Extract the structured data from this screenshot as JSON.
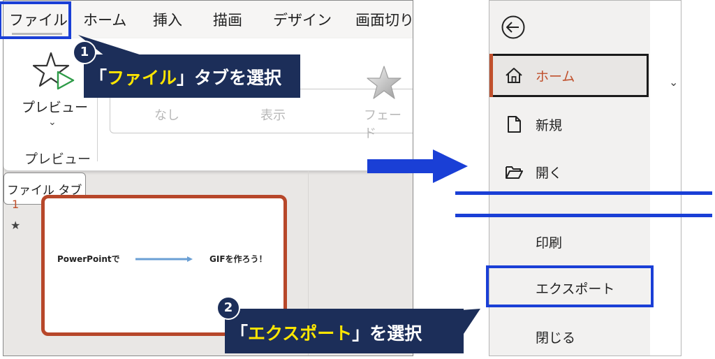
{
  "ribbon": {
    "tabs": [
      "ファイル",
      "ホーム",
      "挿入",
      "描画",
      "デザイン",
      "画面切り"
    ],
    "preview_button_label": "プレビュー",
    "preview_group_label": "プレビュー",
    "effects": [
      "なし",
      "表示",
      "フェード"
    ],
    "tooltip": "ファイル タブ"
  },
  "slide_panel": {
    "slide_number": "1",
    "slide_text_left": "PowerPointで",
    "slide_text_right": "GIFを作ろう！"
  },
  "callouts": {
    "step1_badge": "1",
    "step1_open": "「",
    "step1_highlight": "ファイル",
    "step1_close": "」タブを選択",
    "step2_badge": "2",
    "step2_open": "「",
    "step2_highlight": "エクスポート",
    "step2_close": "」を選択"
  },
  "backstage": {
    "home": "ホーム",
    "new": "新規",
    "open": "開く",
    "print": "印刷",
    "export": "エクスポート",
    "close": "閉じる"
  },
  "colors": {
    "highlight_blue": "#1a3fd6",
    "callout_navy": "#1c2e59",
    "callout_text_yellow": "#ffe600",
    "accent_red": "#c0502c"
  }
}
